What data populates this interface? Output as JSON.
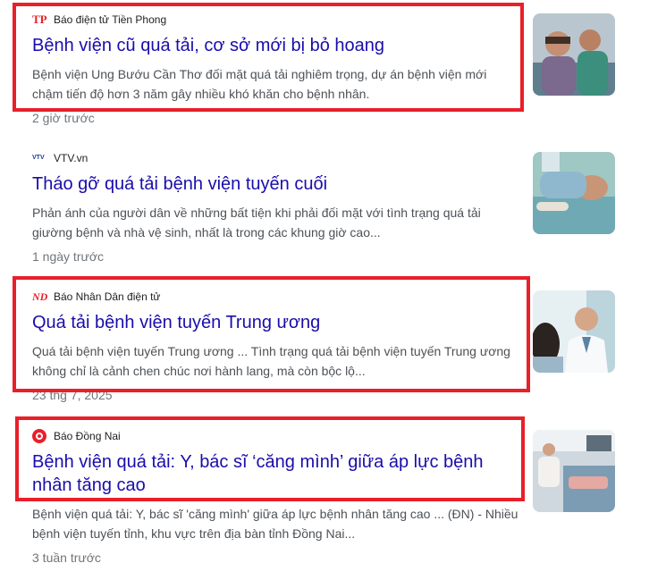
{
  "results": [
    {
      "source": "Báo điện tử Tiền Phong",
      "favicon_text": "TP",
      "title": "Bệnh viện cũ quá tải, cơ sở mới bị bỏ hoang",
      "snippet": "Bệnh viện Ung Bướu Cần Thơ đối mặt quá tải nghiêm trọng, dự án bệnh viện mới chậm tiến độ hơn 3 năm gây nhiều khó khăn cho bệnh nhân.",
      "time": "2 giờ trước",
      "highlighted": true
    },
    {
      "source": "VTV.vn",
      "favicon_text": "VTV",
      "title": "Tháo gỡ quá tải bệnh viện tuyến cuối",
      "snippet": "Phản ánh của người dân về những bất tiện khi phải đối mặt với tình trạng quá tải giường bệnh và nhà vệ sinh, nhất là trong các khung giờ cao...",
      "time": "1 ngày trước",
      "highlighted": false
    },
    {
      "source": "Báo Nhân Dân điện tử",
      "favicon_text": "ND",
      "title": "Quá tải bệnh viện tuyến Trung ương",
      "snippet": "Quá tải bệnh viện tuyến Trung ương ... Tình trạng quá tải bệnh viện tuyến Trung ương không chỉ là cảnh chen chúc nơi hành lang, mà còn bộc lộ...",
      "time": "23 thg 7, 2025",
      "highlighted": true
    },
    {
      "source": "Báo Đồng Nai",
      "favicon_text": "",
      "title": "Bệnh viện quá tải: Y, bác sĩ ‘căng mình’ giữa áp lực bệnh nhân tăng cao",
      "snippet": "Bệnh viện quá tải: Y, bác sĩ 'căng mình' giữa áp lực bệnh nhân tăng cao ... (ĐN) - Nhiều bệnh viện tuyến tỉnh, khu vực trên địa bàn tỉnh Đồng Nai...",
      "time": "3 tuần trước",
      "highlighted": true
    }
  ],
  "colors": {
    "link": "#1a0dab",
    "snippet": "#4d5156",
    "time": "#70757a",
    "highlight": "#e8202a"
  }
}
